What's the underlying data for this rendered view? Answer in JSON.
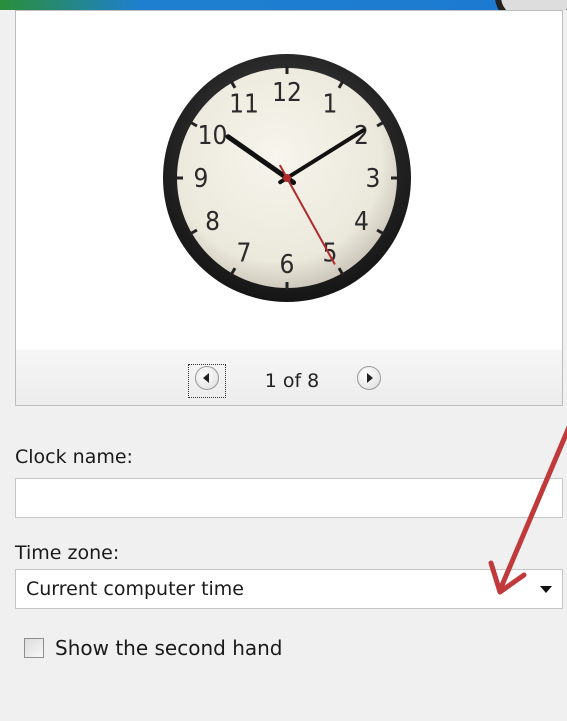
{
  "preview": {
    "clock_face": {
      "numbers": [
        "12",
        "1",
        "2",
        "3",
        "4",
        "5",
        "6",
        "7",
        "8",
        "9",
        "10",
        "11"
      ],
      "hour_hand_angle_deg": 305,
      "minute_hand_angle_deg": 58,
      "second_hand_angle_deg": 151
    }
  },
  "pager": {
    "current": "1",
    "total": "8",
    "text": "1 of 8",
    "prev_icon": "left-arrow-icon",
    "next_icon": "right-arrow-icon"
  },
  "form": {
    "clock_name_label": "Clock name:",
    "clock_name_value": "",
    "time_zone_label": "Time zone:",
    "time_zone_value": "Current computer time",
    "second_hand_label": "Show the second hand",
    "second_hand_checked": false
  },
  "annotation": {
    "color": "#c0393b"
  }
}
